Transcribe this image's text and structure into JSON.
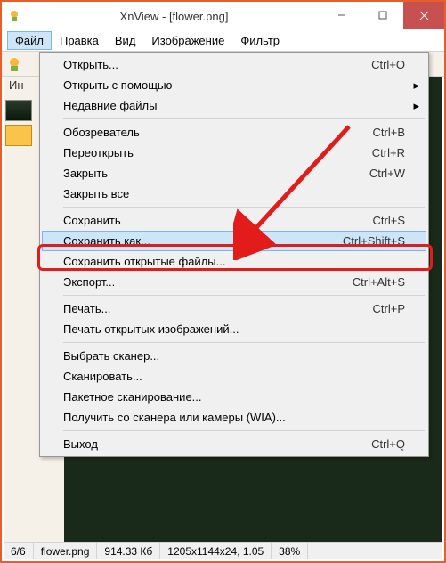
{
  "window": {
    "title": "XnView - [flower.png]"
  },
  "menubar": {
    "items": [
      "Файл",
      "Правка",
      "Вид",
      "Изображение",
      "Фильтр"
    ],
    "open_index": 0
  },
  "toolbar": {
    "label_fragment": "Ин"
  },
  "dropdown": {
    "groups": [
      [
        {
          "label": "Открыть...",
          "shortcut": "Ctrl+O",
          "submenu": false
        },
        {
          "label": "Открыть с помощью",
          "shortcut": "",
          "submenu": true
        },
        {
          "label": "Недавние файлы",
          "shortcut": "",
          "submenu": true
        }
      ],
      [
        {
          "label": "Обозреватель",
          "shortcut": "Ctrl+B",
          "submenu": false
        },
        {
          "label": "Переоткрыть",
          "shortcut": "Ctrl+R",
          "submenu": false
        },
        {
          "label": "Закрыть",
          "shortcut": "Ctrl+W",
          "submenu": false
        },
        {
          "label": "Закрыть все",
          "shortcut": "",
          "submenu": false
        }
      ],
      [
        {
          "label": "Сохранить",
          "shortcut": "Ctrl+S",
          "submenu": false
        },
        {
          "label": "Сохранить как...",
          "shortcut": "Ctrl+Shift+S",
          "submenu": false,
          "highlighted": true
        },
        {
          "label": "Сохранить открытые файлы...",
          "shortcut": "",
          "submenu": false
        },
        {
          "label": "Экспорт...",
          "shortcut": "Ctrl+Alt+S",
          "submenu": false
        }
      ],
      [
        {
          "label": "Печать...",
          "shortcut": "Ctrl+P",
          "submenu": false
        },
        {
          "label": "Печать открытых изображений...",
          "shortcut": "",
          "submenu": false
        }
      ],
      [
        {
          "label": "Выбрать сканер...",
          "shortcut": "",
          "submenu": false
        },
        {
          "label": "Сканировать...",
          "shortcut": "",
          "submenu": false
        },
        {
          "label": "Пакетное сканирование...",
          "shortcut": "",
          "submenu": false
        },
        {
          "label": "Получить со сканера или камеры (WIA)...",
          "shortcut": "",
          "submenu": false
        }
      ],
      [
        {
          "label": "Выход",
          "shortcut": "Ctrl+Q",
          "submenu": false
        }
      ]
    ]
  },
  "statusbar": {
    "page": "6/6",
    "filename": "flower.png",
    "filesize": "914.33 Кб",
    "dimensions": "1205x1144x24, 1.05",
    "zoom": "38%"
  },
  "colors": {
    "accent_border": "#e85d2a",
    "highlight_red": "#e21b1b",
    "menu_hover": "#cde6f7"
  }
}
